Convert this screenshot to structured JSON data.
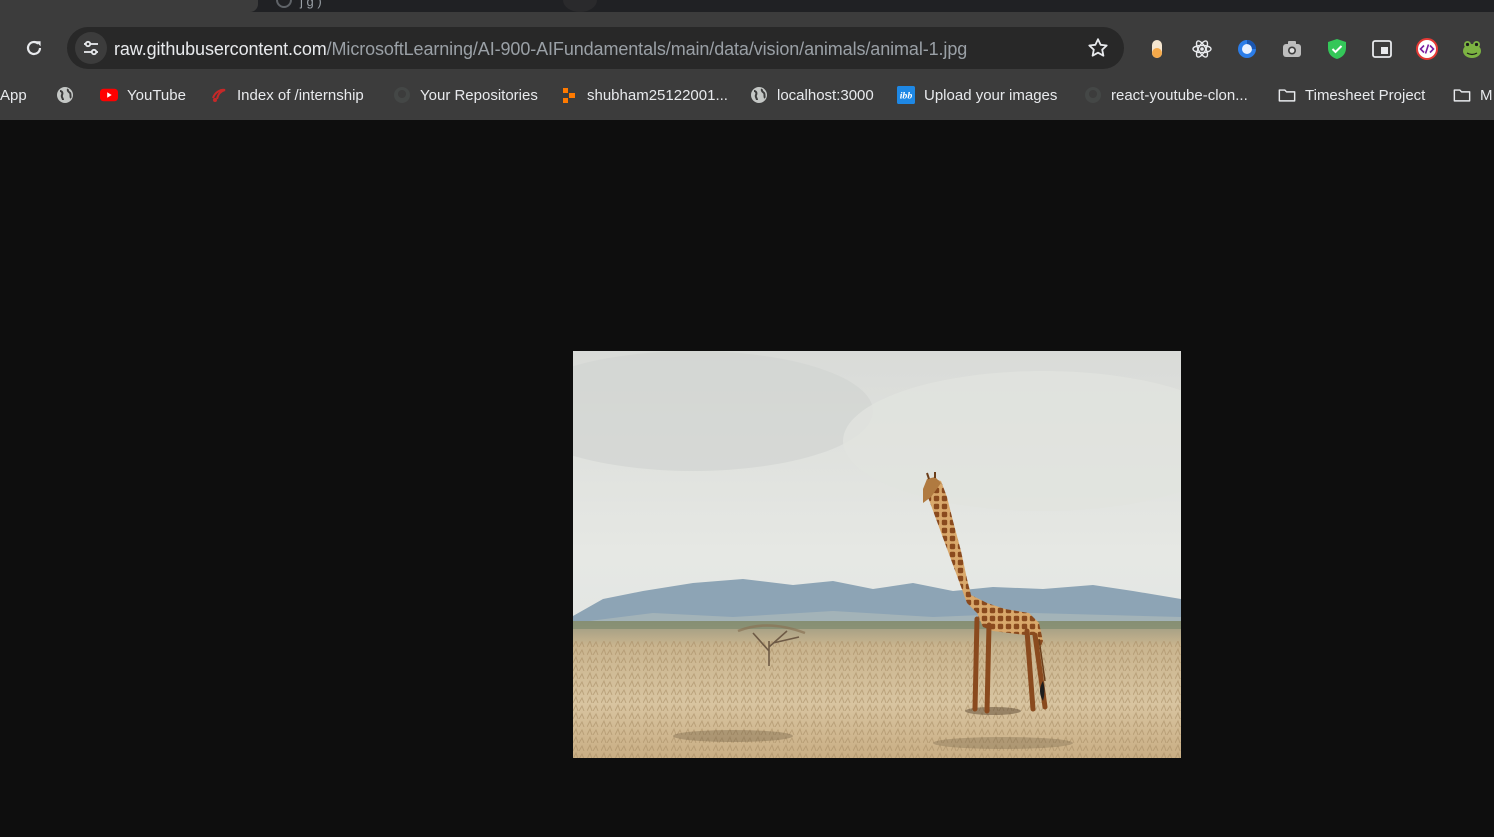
{
  "tabs": {
    "inactive_title_fragment": "j g   )"
  },
  "address_bar": {
    "host": "raw.githubusercontent.com",
    "path": "/MicrosoftLearning/AI-900-AIFundamentals/main/data/vision/animals/animal-1.jpg"
  },
  "toolbar": {
    "reload_icon": "reload-icon",
    "site_info_icon": "tune-icon",
    "bookmark_icon": "star-icon"
  },
  "extensions": [
    {
      "name": "orange-capsule-extension-icon",
      "color": "#f4a94a"
    },
    {
      "name": "react-atom-extension-icon",
      "color": "#e8eaed"
    },
    {
      "name": "blue-circle-extension-icon",
      "color": "#2b7de9"
    },
    {
      "name": "camera-extension-icon",
      "color": "#bdbdbd"
    },
    {
      "name": "green-shield-extension-icon",
      "color": "#34c759"
    },
    {
      "name": "window-extension-icon",
      "color": "#e8eaed"
    },
    {
      "name": "code-extension-icon",
      "color": "#e53935"
    },
    {
      "name": "frog-extension-icon",
      "color": "#7cb342"
    }
  ],
  "bookmarks": [
    {
      "label": "App",
      "icon": "app-icon"
    },
    {
      "label": "",
      "icon": "globe-icon"
    },
    {
      "label": "YouTube",
      "icon": "youtube-icon"
    },
    {
      "label": "Index of /internship",
      "icon": "index-favicon-icon"
    },
    {
      "label": "Your Repositories",
      "icon": "github-icon"
    },
    {
      "label": "shubham25122001...",
      "icon": "orange-blocks-icon"
    },
    {
      "label": "localhost:3000",
      "icon": "globe-icon"
    },
    {
      "label": "Upload your images",
      "icon": "ibb-icon"
    },
    {
      "label": "react-youtube-clon...",
      "icon": "github-icon"
    },
    {
      "label": "Timesheet Project",
      "icon": "folder-icon"
    },
    {
      "label": "M",
      "icon": "folder-icon"
    }
  ],
  "content": {
    "image_subject": "giraffe-photo"
  },
  "colors": {
    "chrome": "#3c3c3c",
    "omnibox": "#282828",
    "page_background": "#0e0e0e"
  }
}
